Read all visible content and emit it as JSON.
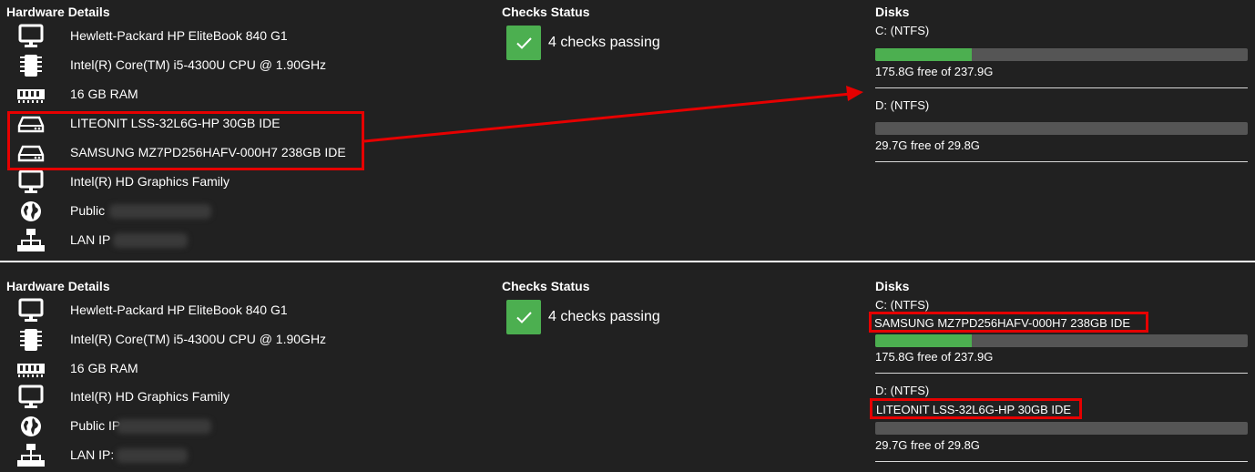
{
  "accent_green": "#4caf50",
  "annotation_red": "#e60000",
  "top": {
    "hardware": {
      "title": "Hardware Details",
      "items": [
        {
          "icon": "monitor-icon",
          "label": "Hewlett-Packard HP EliteBook 840 G1"
        },
        {
          "icon": "cpu-icon",
          "label": "Intel(R) Core(TM) i5-4300U CPU @ 1.90GHz"
        },
        {
          "icon": "ram-icon",
          "label": "16 GB RAM"
        },
        {
          "icon": "hard-drive-icon",
          "label": "LITEONIT LSS-32L6G-HP 30GB IDE"
        },
        {
          "icon": "hard-drive-icon",
          "label": "SAMSUNG MZ7PD256HAFV-000H7 238GB IDE"
        },
        {
          "icon": "monitor-icon",
          "label": "Intel(R) HD Graphics Family"
        },
        {
          "icon": "globe-icon",
          "label": "Public"
        },
        {
          "icon": "network-icon",
          "label": "LAN IP"
        }
      ]
    },
    "checks": {
      "title": "Checks Status",
      "text": "4 checks passing"
    },
    "disks": {
      "title": "Disks",
      "items": [
        {
          "name": "C: (NTFS)",
          "free_text": "175.8G free of 237.9G",
          "used_fraction": 0.26
        },
        {
          "name": "D: (NTFS)",
          "free_text": "29.7G free of 29.8G",
          "used_fraction": 0.0
        }
      ]
    }
  },
  "bottom": {
    "hardware": {
      "title": "Hardware Details",
      "items": [
        {
          "icon": "monitor-icon",
          "label": "Hewlett-Packard HP EliteBook 840 G1"
        },
        {
          "icon": "cpu-icon",
          "label": "Intel(R) Core(TM) i5-4300U CPU @ 1.90GHz"
        },
        {
          "icon": "ram-icon",
          "label": "16 GB RAM"
        },
        {
          "icon": "monitor-icon",
          "label": "Intel(R) HD Graphics Family"
        },
        {
          "icon": "globe-icon",
          "label": "Public IP"
        },
        {
          "icon": "network-icon",
          "label": "LAN IP:"
        }
      ]
    },
    "checks": {
      "title": "Checks Status",
      "text": "4 checks passing"
    },
    "disks": {
      "title": "Disks",
      "items": [
        {
          "name": "C: (NTFS)",
          "device": "SAMSUNG MZ7PD256HAFV-000H7 238GB IDE",
          "free_text": "175.8G free of 237.9G",
          "used_fraction": 0.26
        },
        {
          "name": "D: (NTFS)",
          "device": "LITEONIT LSS-32L6G-HP 30GB IDE",
          "free_text": "29.7G free of 29.8G",
          "used_fraction": 0.0
        }
      ]
    }
  }
}
